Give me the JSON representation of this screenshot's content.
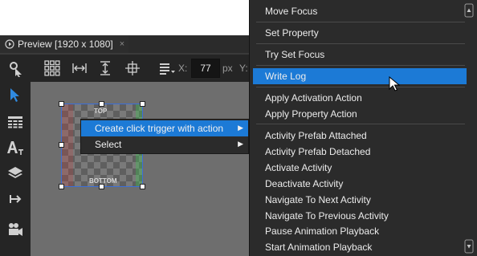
{
  "preview_tab": {
    "title": "Preview [1920 x 1080]",
    "close": "×"
  },
  "toolbar": {
    "x_label": "X:",
    "x_value": "77",
    "x_unit": "px",
    "y_label": "Y:"
  },
  "left_tools": [
    "pointer-tool-icon",
    "select-tool-icon",
    "grid-tool-icon",
    "text-tool-icon",
    "layers-tool-icon",
    "share-tool-icon",
    "camera-tool-icon"
  ],
  "canvas": {
    "top_label": "TOP",
    "bottom_label": "BOTTOM"
  },
  "context_menu": {
    "items": [
      {
        "label": "Create click trigger with action",
        "highlighted": true
      },
      {
        "label": "Select",
        "highlighted": false
      }
    ]
  },
  "submenu": {
    "items": [
      "Move Focus",
      "Set Property",
      "Try Set Focus",
      "Write Log",
      "Apply Activation Action",
      "Apply Property Action",
      "Activity Prefab Attached",
      "Activity Prefab Detached",
      "Activate Activity",
      "Deactivate Activity",
      "Navigate To Next Activity",
      "Navigate To Previous Activity",
      "Pause Animation Playback",
      "Start Animation Playback"
    ],
    "highlighted_index": 3
  },
  "colors": {
    "accent": "#1c7ad6",
    "selection": "#3b6fd9"
  }
}
